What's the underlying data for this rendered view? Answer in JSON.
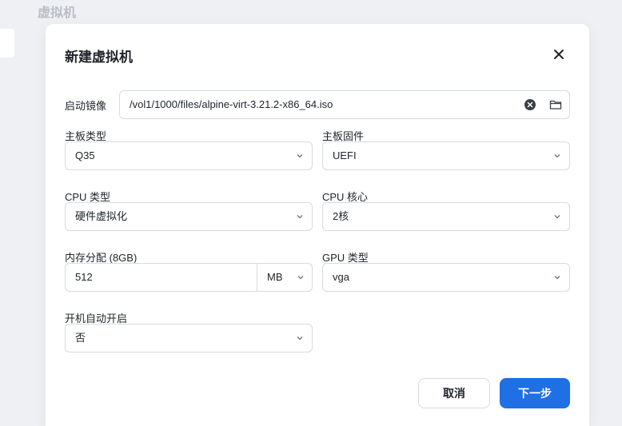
{
  "background": {
    "page_title": "虚拟机"
  },
  "dialog": {
    "title": "新建虚拟机",
    "close_icon": "close-icon",
    "boot_image": {
      "label": "启动镜像",
      "value": "/vol1/1000/files/alpine-virt-3.21.2-x86_64.iso",
      "clear_icon": "clear-circle-icon",
      "folder_icon": "folder-icon"
    },
    "motherboard_type": {
      "label": "主板类型",
      "value": "Q35"
    },
    "motherboard_firmware": {
      "label": "主板固件",
      "value": "UEFI"
    },
    "cpu_type": {
      "label": "CPU 类型",
      "value": "硬件虚拟化"
    },
    "cpu_cores": {
      "label": "CPU 核心",
      "value": "2核"
    },
    "memory": {
      "label": "内存分配 (8GB)",
      "value": "512",
      "unit": "MB"
    },
    "gpu_type": {
      "label": "GPU 类型",
      "value": "vga"
    },
    "autostart": {
      "label": "开机自动开启",
      "value": "否"
    },
    "buttons": {
      "cancel": "取消",
      "next": "下一步"
    }
  },
  "colors": {
    "primary": "#1f6fe5",
    "border": "#d7dbe1",
    "text": "#1f2329",
    "page_bg": "#eef0f3"
  }
}
